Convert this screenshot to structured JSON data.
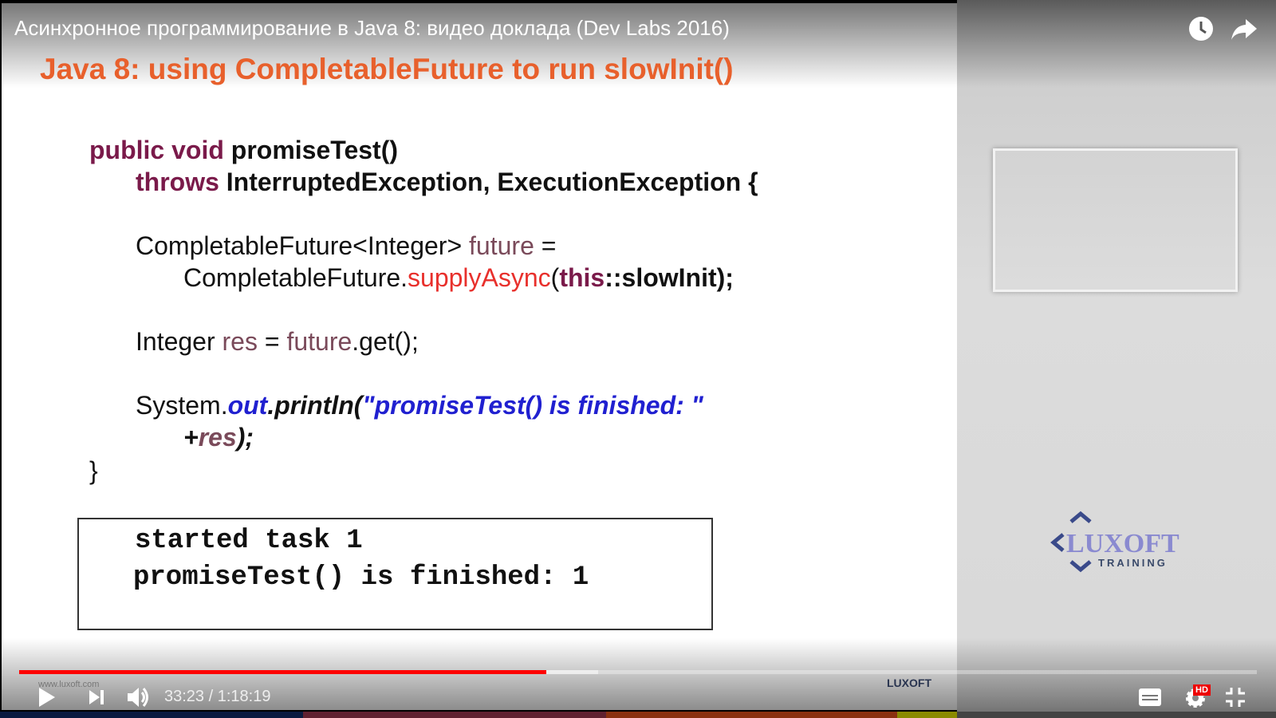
{
  "video": {
    "title": "Асинхронное программирование в Java 8: видео доклада (Dev Labs 2016)"
  },
  "slide": {
    "heading": "Java 8: using CompletableFuture to run slowInit()",
    "code": {
      "l1_kw": "public void",
      "l1_rest": " promiseTest()",
      "l2_kw": "throws",
      "l2_rest": " InterruptedException, ExecutionException {",
      "l3_a": "CompletableFuture<Integer> ",
      "l3_var": "future",
      "l3_b": " =",
      "l4_a": "CompletableFuture.",
      "l4_call": "supplyAsync",
      "l4_b": "(",
      "l4_this": "this",
      "l4_c": "::slowInit);",
      "l5_a": "Integer ",
      "l5_var": "res",
      "l5_b": " = ",
      "l5_var2": "future",
      "l5_c": ".get();",
      "l6_a": "System.",
      "l6_out": "out",
      "l6_b": ".println(",
      "l6_str": "\"promiseTest()  is finished:  \"",
      "l7_a": "+",
      "l7_var": "res",
      "l7_b": ");",
      "l8": "}"
    },
    "output": [
      "started task 1",
      "promiseTest() is finished: 1"
    ],
    "site": "www.luxoft.com",
    "brand": "LUXOFT"
  },
  "side": {
    "logo_text": "LUXOFT",
    "logo_sub": "TRAINING"
  },
  "player": {
    "current_time": "33:23",
    "duration": "1:18:19",
    "time_display": "33:23 / 1:18:19",
    "played_fraction": 0.426,
    "buffered_fraction": 0.468,
    "hd_badge": "HD"
  }
}
